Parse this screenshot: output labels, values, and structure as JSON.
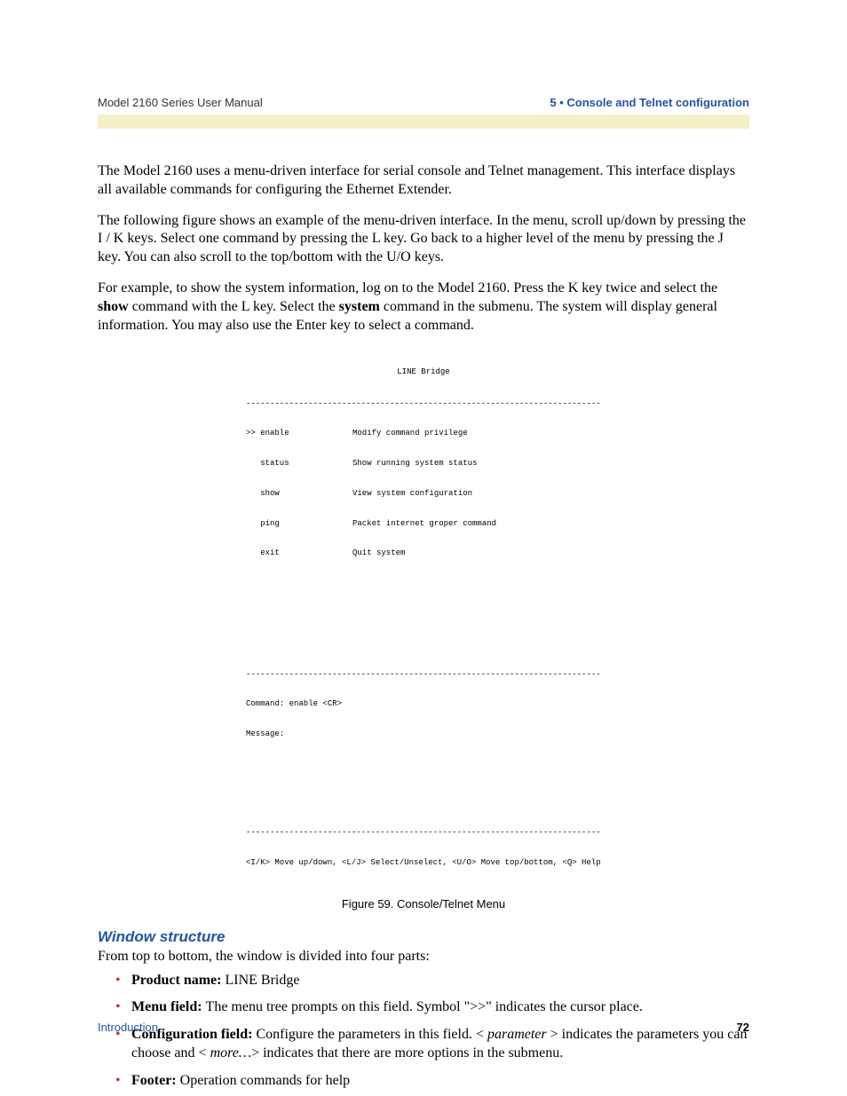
{
  "header": {
    "left": "Model 2160 Series User Manual",
    "right": "5 • Console and Telnet configuration"
  },
  "paragraphs": {
    "p1": "The Model 2160 uses a menu-driven interface for serial console and Telnet management. This interface displays all available commands for configuring the Ethernet Extender.",
    "p2": "The following figure shows an example of the menu-driven interface. In the menu, scroll up/down by pressing the I / K keys. Select one command by pressing the L key. Go back to a higher level of the menu by pressing the J key. You can also scroll to the top/bottom with the U/O keys.",
    "p3a": "For example, to show the system information, log on to the Model 2160. Press the K key twice and select the ",
    "p3b": "show",
    "p3c": " command with the L key. Select the ",
    "p3d": "system",
    "p3e": " command in the submenu. The system will display general information. You may also use the Enter key to select a command."
  },
  "console": {
    "title": "LINE Bridge",
    "dashes_top": "-----------------------------------------------------------------------------",
    "rows": [
      {
        "left": ">> enable",
        "right": "Modify command privilege"
      },
      {
        "left": "   status",
        "right": "Show running system status"
      },
      {
        "left": "   show",
        "right": "View system configuration"
      },
      {
        "left": "   ping",
        "right": "Packet internet groper command"
      },
      {
        "left": "   exit",
        "right": "Quit system"
      }
    ],
    "dashes_mid": "-----------------------------------------------------------------------------",
    "cmd_line": "Command: enable <CR>",
    "msg_line": "Message:",
    "dashes_bot": "-----------------------------------------------------------------------------",
    "footer_help": "<I/K> Move up/down, <L/J> Select/Unselect, <U/O> Move top/bottom, <Q> Help"
  },
  "caption": "Figure 59. Console/Telnet Menu",
  "section_heading": "Window structure",
  "section_intro": "From top to bottom, the window is divided into four parts:",
  "bullets": {
    "b1_label": "Product name: ",
    "b1_value": "LINE Bridge",
    "b2_label": "Menu field: ",
    "b2_value": "The menu tree prompts on this field. Symbol \">>\" indicates the cursor place.",
    "b3_label": "Configuration field: ",
    "b3_a": "Configure the parameters in this field. < ",
    "b3_param": "parameter",
    "b3_b": " > indicates the parameters you can choose and < ",
    "b3_more": "more…",
    "b3_c": "> indicates that there are more options in the submenu.",
    "b4_label": "Footer: ",
    "b4_value": "Operation commands for help"
  },
  "footer": {
    "left": "Introduction",
    "page": "72"
  }
}
